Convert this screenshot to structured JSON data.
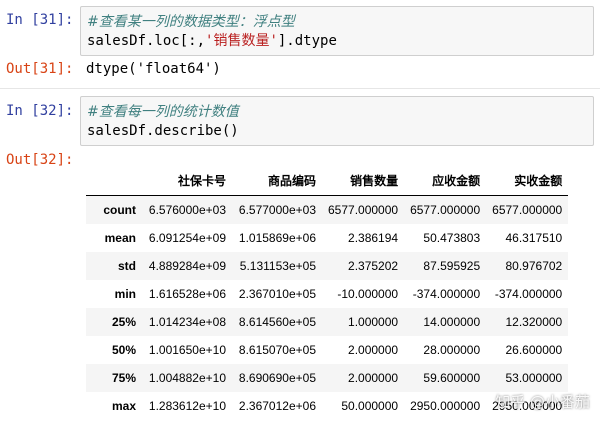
{
  "cells": [
    {
      "in_prompt": "In [31]:",
      "comment": "#查看某一列的数据类型：浮点型",
      "code_pre": "salesDf.loc[:,",
      "code_str": "'销售数量'",
      "code_post": "].dtype",
      "out_prompt": "Out[31]:",
      "output": "dtype('float64')"
    },
    {
      "in_prompt": "In [32]:",
      "comment": "#查看每一列的统计数值",
      "code": "salesDf.describe()",
      "out_prompt": "Out[32]:"
    }
  ],
  "describe_table": {
    "columns": [
      "社保卡号",
      "商品编码",
      "销售数量",
      "应收金额",
      "实收金额"
    ],
    "rows": [
      {
        "label": "count",
        "values": [
          "6.576000e+03",
          "6.577000e+03",
          "6577.000000",
          "6577.000000",
          "6577.000000"
        ]
      },
      {
        "label": "mean",
        "values": [
          "6.091254e+09",
          "1.015869e+06",
          "2.386194",
          "50.473803",
          "46.317510"
        ]
      },
      {
        "label": "std",
        "values": [
          "4.889284e+09",
          "5.131153e+05",
          "2.375202",
          "87.595925",
          "80.976702"
        ]
      },
      {
        "label": "min",
        "values": [
          "1.616528e+06",
          "2.367010e+05",
          "-10.000000",
          "-374.000000",
          "-374.000000"
        ]
      },
      {
        "label": "25%",
        "values": [
          "1.014234e+08",
          "8.614560e+05",
          "1.000000",
          "14.000000",
          "12.320000"
        ]
      },
      {
        "label": "50%",
        "values": [
          "1.001650e+10",
          "8.615070e+05",
          "2.000000",
          "28.000000",
          "26.600000"
        ]
      },
      {
        "label": "75%",
        "values": [
          "1.004882e+10",
          "8.690690e+05",
          "2.000000",
          "59.600000",
          "53.000000"
        ]
      },
      {
        "label": "max",
        "values": [
          "1.283612e+10",
          "2.367012e+06",
          "50.000000",
          "2950.000000",
          "2950.000000"
        ]
      }
    ]
  },
  "watermark": "知乎 @小番茄",
  "colors": {
    "in_prompt": "#303F9F",
    "out_prompt": "#D84315",
    "comment": "#408080",
    "string": "#BA2121"
  }
}
